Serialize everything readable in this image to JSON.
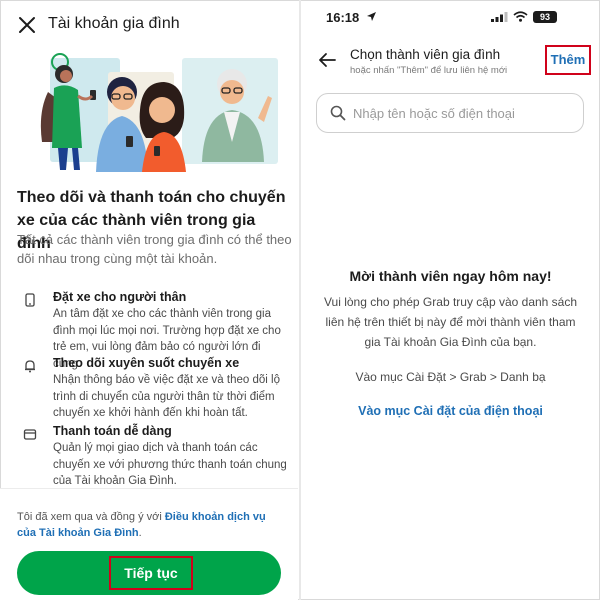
{
  "left": {
    "title": "Tài khoản gia đình",
    "headline": "Theo dõi và thanh toán cho chuyến xe của các thành viên trong gia đình",
    "subline": "Tất cả các thành viên trong gia đình có thể theo dõi nhau trong cùng một tài khoản.",
    "features": [
      {
        "icon": "phone-icon",
        "title": "Đặt xe cho người thân",
        "desc": "An tâm đặt xe cho các thành viên trong gia đình mọi lúc mọi nơi. Trường hợp đặt xe cho trẻ em, vui lòng đảm bảo có người lớn đi cùng."
      },
      {
        "icon": "bell-icon",
        "title": "Theo dõi xuyên suốt chuyến xe",
        "desc": "Nhận thông báo về việc đặt xe và theo dõi lộ trình di chuyển của người thân từ thời điểm chuyến xe khởi hành đến khi hoàn tất."
      },
      {
        "icon": "wallet-icon",
        "title": "Thanh toán dễ dàng",
        "desc": "Quản lý mọi giao dịch và thanh toán các chuyến xe với phương thức thanh toán chung của Tài khoản Gia Đình."
      }
    ],
    "terms_prefix": "Tôi đã xem qua và đồng ý với ",
    "terms_link": "Điều khoản dịch vụ của Tài khoản Gia Đình",
    "terms_suffix": ".",
    "cta_label": "Tiếp tục"
  },
  "right": {
    "status": {
      "time": "16:18",
      "battery": "93"
    },
    "title": "Chọn thành viên gia đình",
    "subtitle": "hoặc nhấn \"Thêm\" để lưu liên hệ mới",
    "add_label": "Thêm",
    "search_placeholder": "Nhập tên hoặc số điện thoại",
    "invite_title": "Mời thành viên ngay hôm nay!",
    "invite_desc": "Vui lòng cho phép Grab truy cập vào danh sách liên hệ trên thiết bị này để mời thành viên tham gia Tài khoản Gia Đình của bạn.",
    "invite_path": "Vào mục Cài Đặt > Grab > Danh bạ",
    "invite_link": "Vào mục Cài đặt của điện thoại"
  },
  "colors": {
    "brand_green": "#00a44a",
    "link_blue": "#1f6fb5",
    "highlight_red": "#d0021b"
  }
}
